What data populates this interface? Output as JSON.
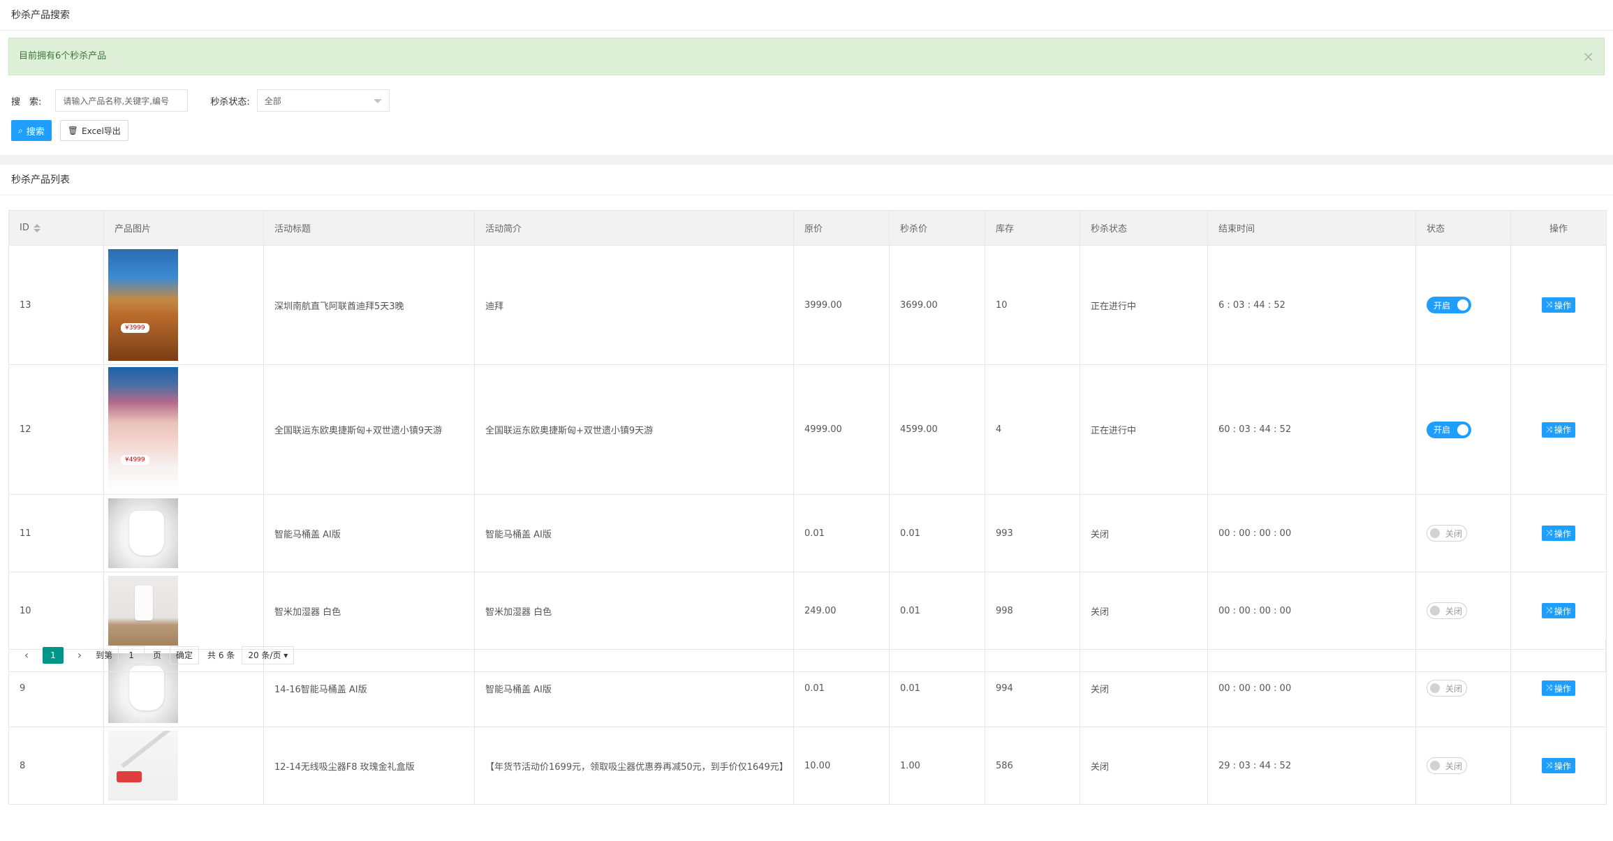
{
  "search_panel": {
    "title": "秒杀产品搜索",
    "alert_text": "目前拥有6个秒杀产品",
    "alert_close": "×",
    "search_label": "搜　索:",
    "search_placeholder": "请输入产品名称,关键字,编号",
    "status_label": "秒杀状态:",
    "status_value": "全部",
    "search_button": "搜索",
    "export_button": "Excel导出"
  },
  "list_panel": {
    "title": "秒杀产品列表",
    "columns": [
      "ID",
      "产品图片",
      "活动标题",
      "活动简介",
      "原价",
      "秒杀价",
      "库存",
      "秒杀状态",
      "结束时间",
      "状态",
      "操作"
    ],
    "rows": [
      {
        "id": "13",
        "title": "深圳南航直飞阿联酋迪拜5天3晚",
        "intro": "迪拜",
        "price": "3999.00",
        "seckill_price": "3699.00",
        "stock": "10",
        "seckill_status": "正在进行中",
        "end_time": "6 : 03 : 44 : 52",
        "switch": "开启",
        "switch_on": true,
        "op": "操作",
        "image": "travel-poster-dubai"
      },
      {
        "id": "12",
        "title": "全国联运东欧奥捷斯匈+双世遗小镇9天游",
        "intro": "全国联运东欧奥捷斯匈+双世遗小镇9天游",
        "price": "4999.00",
        "seckill_price": "4599.00",
        "stock": "4",
        "seckill_status": "正在进行中",
        "end_time": "60 : 03 : 44 : 52",
        "switch": "开启",
        "switch_on": true,
        "op": "操作",
        "image": "travel-poster-europe"
      },
      {
        "id": "11",
        "title": "智能马桶盖 AI版",
        "intro": "智能马桶盖 AI版",
        "price": "0.01",
        "seckill_price": "0.01",
        "stock": "993",
        "seckill_status": "关闭",
        "end_time": "00 : 00 : 00 : 00",
        "switch": "关闭",
        "switch_on": false,
        "op": "操作",
        "image": "toilet"
      },
      {
        "id": "10",
        "title": "智米加湿器 白色",
        "intro": "智米加湿器 白色",
        "price": "249.00",
        "seckill_price": "0.01",
        "stock": "998",
        "seckill_status": "关闭",
        "end_time": "00 : 00 : 00 : 00",
        "switch": "关闭",
        "switch_on": false,
        "op": "操作",
        "image": "humidifier"
      },
      {
        "id": "9",
        "title": "14-16智能马桶盖 AI版",
        "intro": "智能马桶盖 AI版",
        "price": "0.01",
        "seckill_price": "0.01",
        "stock": "994",
        "seckill_status": "关闭",
        "end_time": "00 : 00 : 00 : 00",
        "switch": "关闭",
        "switch_on": false,
        "op": "操作",
        "image": "toilet"
      },
      {
        "id": "8",
        "title": "12-14无线吸尘器F8 玫瑰金礼盒版",
        "intro": "【年货节活动价1699元，领取吸尘器优惠券再减50元，到手价仅1649元】",
        "price": "10.00",
        "seckill_price": "1.00",
        "stock": "586",
        "seckill_status": "关闭",
        "end_time": "29 : 03 : 44 : 52",
        "switch": "关闭",
        "switch_on": false,
        "op": "操作",
        "image": "vacuum"
      }
    ]
  },
  "pager": {
    "current": "1",
    "goto_label": "到第",
    "goto_value": "1",
    "page_label": "页",
    "confirm": "确定",
    "total": "共 6 条",
    "page_size": "20 条/页 ▾"
  },
  "colors": {
    "primary": "#1e9fff",
    "alert_bg": "#dff0d8",
    "pager_active": "#009688"
  },
  "icons": {
    "search": "search-icon",
    "export": "trash-icon",
    "operate": "shuffle-icon"
  }
}
